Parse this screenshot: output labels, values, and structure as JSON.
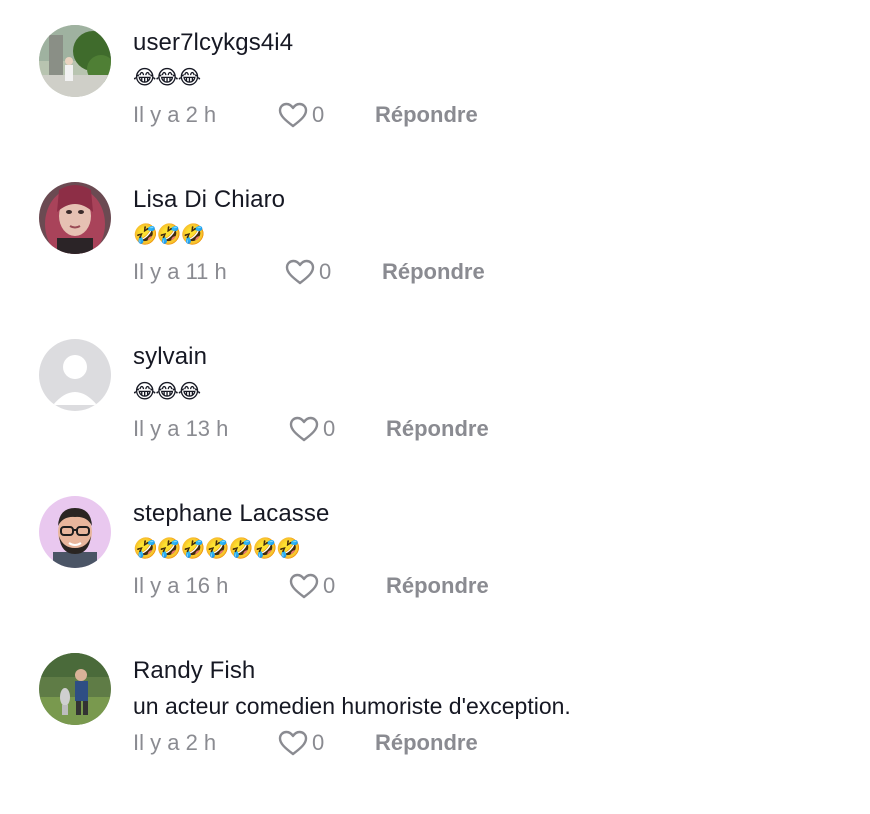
{
  "colors": {
    "text_primary": "#161823",
    "text_secondary": "#8a8b91"
  },
  "comments": [
    {
      "username": "user7lcykgs4i4",
      "text": "😂😂😂",
      "time": "Il y a 2 h",
      "likes": "0",
      "reply_label": "Répondre",
      "avatar": "photo-person-garden"
    },
    {
      "username": "Lisa Di Chiaro",
      "text": "🤣🤣🤣",
      "time": "Il y a 11 h",
      "likes": "0",
      "reply_label": "Répondre",
      "avatar": "photo-woman-red-hair"
    },
    {
      "username": "sylvain",
      "text": "😂😂😂",
      "time": "Il y a 13 h",
      "likes": "0",
      "reply_label": "Répondre",
      "avatar": "default-avatar"
    },
    {
      "username": "stephane Lacasse",
      "text": "🤣🤣🤣🤣🤣🤣🤣",
      "time": "Il y a 16 h",
      "likes": "0",
      "reply_label": "Répondre",
      "avatar": "cartoon-man-glasses"
    },
    {
      "username": "Randy Fish",
      "text": "un acteur comedien humoriste d'exception.",
      "time": "Il y a 2 h",
      "likes": "0",
      "reply_label": "Répondre",
      "avatar": "photo-man-trophy"
    }
  ]
}
